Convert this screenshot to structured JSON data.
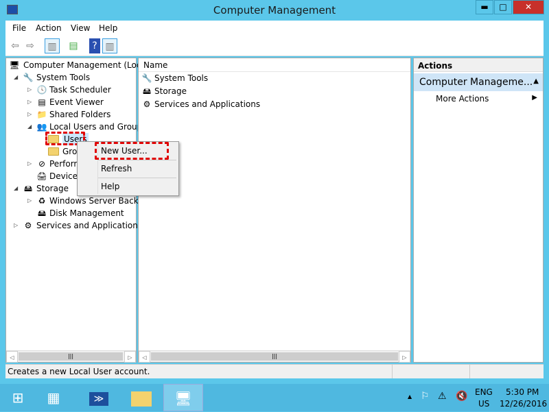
{
  "window": {
    "title": "Computer Management",
    "minimize": "▬",
    "maximize": "□",
    "close": "✕"
  },
  "menu": [
    "File",
    "Action",
    "View",
    "Help"
  ],
  "tree": [
    {
      "label": "Computer Management (Local",
      "level": 0,
      "arrow": "",
      "icon": "computer-icon"
    },
    {
      "label": "System Tools",
      "level": 1,
      "arrow": "◢",
      "icon": "tools-icon"
    },
    {
      "label": "Task Scheduler",
      "level": 2,
      "arrow": "▷",
      "icon": "clock-icon"
    },
    {
      "label": "Event Viewer",
      "level": 2,
      "arrow": "▷",
      "icon": "event-viewer-icon"
    },
    {
      "label": "Shared Folders",
      "level": 2,
      "arrow": "▷",
      "icon": "shared-folder-icon"
    },
    {
      "label": "Local Users and Groups",
      "level": 2,
      "arrow": "◢",
      "icon": "users-icon"
    },
    {
      "label": "Users",
      "level": 3,
      "arrow": "",
      "icon": "folder-icon"
    },
    {
      "label": "Groups",
      "level": 3,
      "arrow": "",
      "icon": "folder-icon"
    },
    {
      "label": "Performance",
      "level": 2,
      "arrow": "▷",
      "icon": "performance-icon"
    },
    {
      "label": "Device Manager",
      "level": 2,
      "arrow": "",
      "icon": "device-manager-icon"
    },
    {
      "label": "Storage",
      "level": 1,
      "arrow": "◢",
      "icon": "storage-icon"
    },
    {
      "label": "Windows Server Backup",
      "level": 2,
      "arrow": "▷",
      "icon": "backup-icon"
    },
    {
      "label": "Disk Management",
      "level": 2,
      "arrow": "",
      "icon": "disk-icon"
    },
    {
      "label": "Services and Applications",
      "level": 1,
      "arrow": "▷",
      "icon": "services-icon"
    }
  ],
  "main": {
    "header": "Name",
    "items": [
      {
        "label": "System Tools",
        "icon": "tools-icon"
      },
      {
        "label": "Storage",
        "icon": "storage-icon"
      },
      {
        "label": "Services and Applications",
        "icon": "services-icon"
      }
    ]
  },
  "actions": {
    "header": "Actions",
    "section": "Computer Manageme...",
    "item": "More Actions"
  },
  "context_menu": {
    "items": [
      "New User...",
      "Refresh",
      "Help"
    ]
  },
  "status": "Creates a new Local User account.",
  "tray": {
    "lang1": "ENG",
    "lang2": "US",
    "time": "5:30 PM",
    "date": "12/26/2016"
  },
  "colors": {
    "accent": "#5bc7ea",
    "highlight": "#e00000"
  }
}
